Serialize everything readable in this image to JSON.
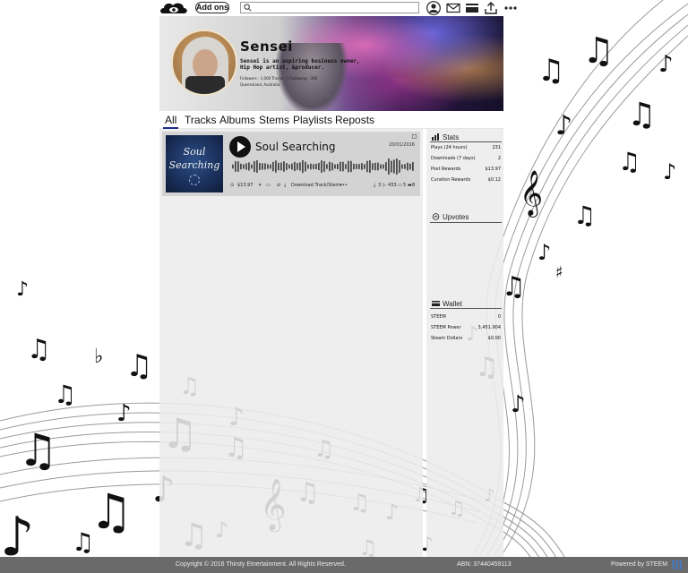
{
  "topbar": {
    "addons_label": "Add ons",
    "search_placeholder": "",
    "icons": [
      "logo-eye-cloud",
      "search-icon",
      "avatar-icon",
      "mail-icon",
      "card-icon",
      "upload-icon",
      "more-icon"
    ]
  },
  "profile": {
    "name": "Sensei",
    "bio_line1": "Sensei is an aspiring business owner,",
    "bio_line2": "Hip Hop artist, &producer.",
    "stats_line": "Followers - 1,000    Tracks - 1    Following - 300",
    "location": "Queensland, Australia"
  },
  "tabs": [
    "All",
    "Tracks",
    "Albums",
    "Stems",
    "Playlists",
    "Reposts"
  ],
  "active_tab": "All",
  "track": {
    "cover_line1": "Soul",
    "cover_line2": "Searching",
    "title": "Soul Searching",
    "date": "20/01/2016",
    "price": "$13.97",
    "download_label": "Download Track/Stems",
    "more": "•••",
    "downloads": "3",
    "plays": "433",
    "comments": "5",
    "likes": "8"
  },
  "stats": {
    "title": "Stats",
    "rows": [
      {
        "label": "Plays (24 hours)",
        "value": "231"
      },
      {
        "label": "Downloads (7 days)",
        "value": "2"
      },
      {
        "label": "Post Rewards",
        "value": "$13.97"
      },
      {
        "label": "Curation Rewards",
        "value": "$0.12"
      }
    ]
  },
  "upvotes": {
    "title": "Upvotes"
  },
  "wallet": {
    "title": "Wallet",
    "rows": [
      {
        "label": "STEEM",
        "value": "0"
      },
      {
        "label": "STEEM Power",
        "value": "3,451.904"
      },
      {
        "label": "Steem Dollars",
        "value": "$0.00"
      }
    ]
  },
  "footer": {
    "copyright": "Copyright © 2016 Thirsty Etnertainment. All Rights Reserved.",
    "abn": "ABN: 37440459113",
    "powered": "Powered by STEEM"
  },
  "colors": {
    "tab_underline": "#1a2a8a",
    "footer_bg": "#6a6a6a",
    "card_bg": "#d3d3d3",
    "panel_bg": "#ececec"
  }
}
